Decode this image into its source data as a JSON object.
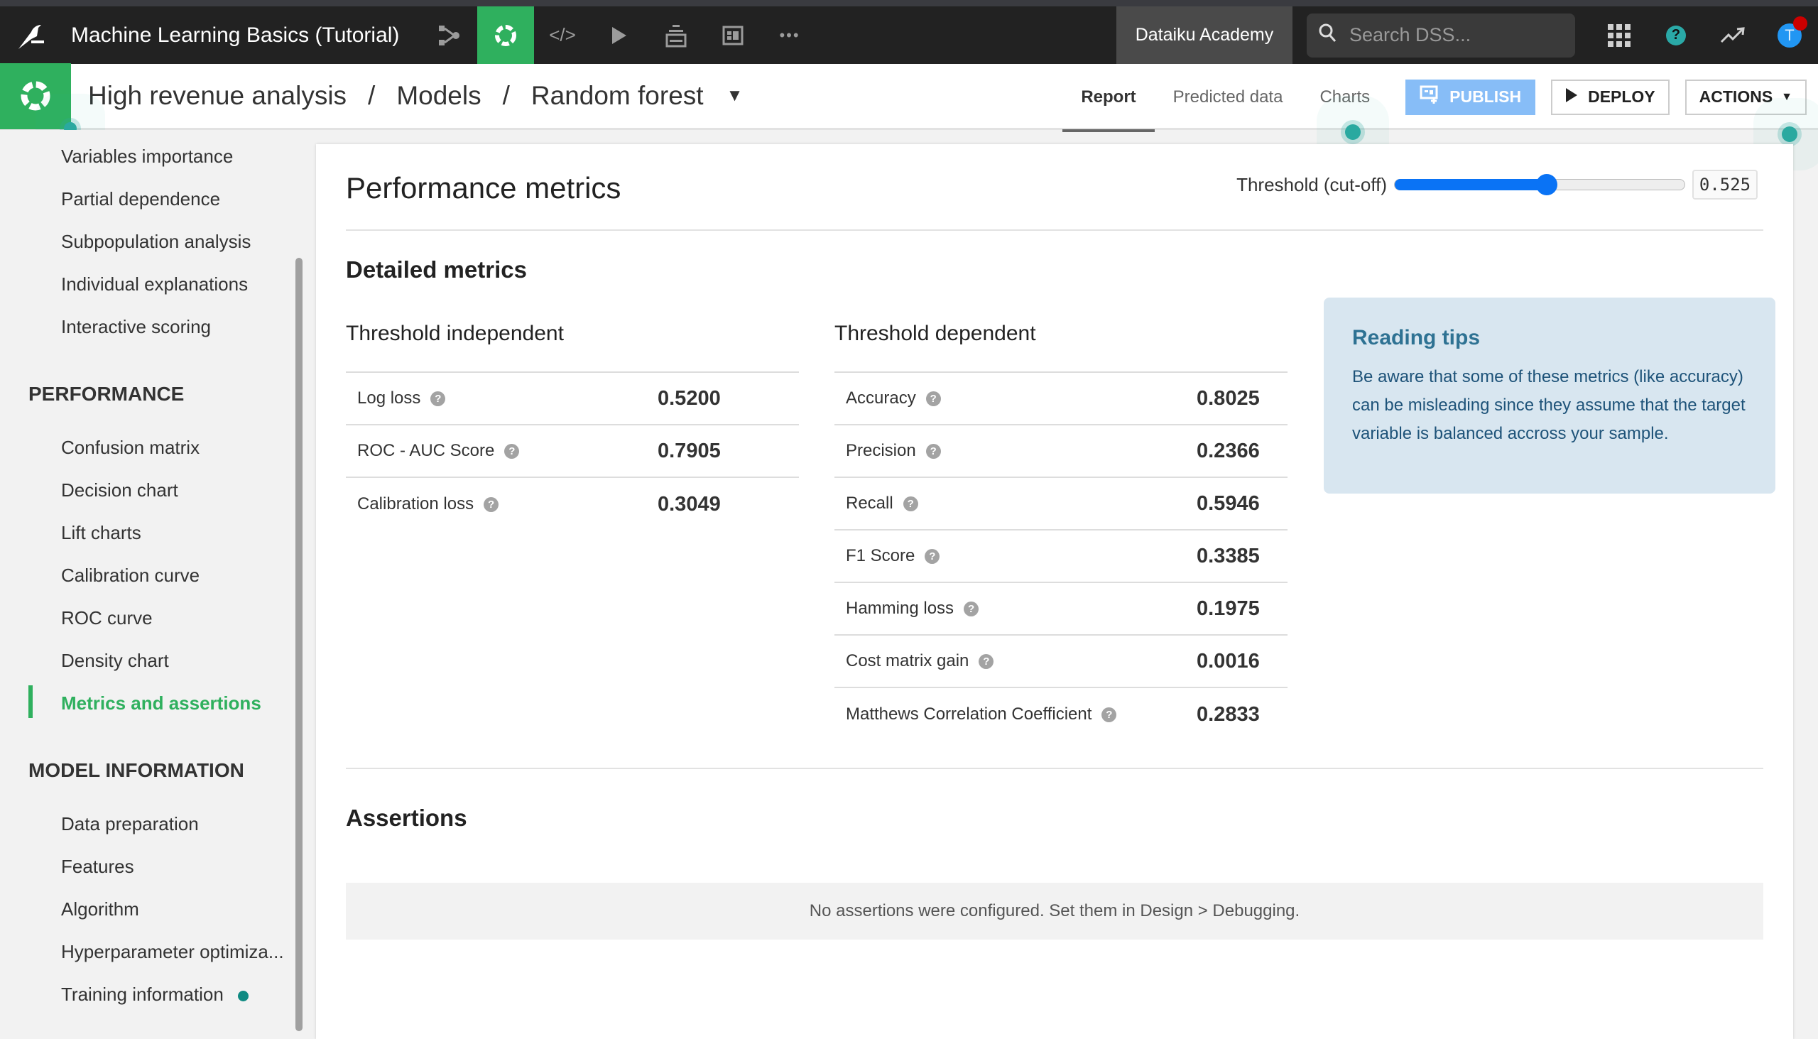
{
  "navbar": {
    "project_title": "Machine Learning Basics (Tutorial)",
    "icons": [
      "flow-icon",
      "ml-icon",
      "code-icon",
      "run-icon",
      "stack-icon",
      "dashboard-icon",
      "more-icon"
    ],
    "academy_label": "Dataiku Academy",
    "search_placeholder": "Search DSS...",
    "avatar_letter": "T"
  },
  "subheader": {
    "breadcrumb": [
      "High revenue analysis",
      "Models",
      "Random forest"
    ],
    "separator": "/",
    "tabs": [
      "Report",
      "Predicted data",
      "Charts"
    ],
    "active_tab": "Report",
    "publish_label": "PUBLISH",
    "deploy_label": "DEPLOY",
    "actions_label": "ACTIONS"
  },
  "sidebar": {
    "items_top": [
      "Variables importance",
      "Partial dependence",
      "Subpopulation analysis",
      "Individual explanations",
      "Interactive scoring"
    ],
    "performance_header": "PERFORMANCE",
    "performance_items": [
      "Confusion matrix",
      "Decision chart",
      "Lift charts",
      "Calibration curve",
      "ROC curve",
      "Density chart",
      "Metrics and assertions"
    ],
    "active_item": "Metrics and assertions",
    "model_info_header": "MODEL INFORMATION",
    "model_info_items": [
      "Data preparation",
      "Features",
      "Algorithm",
      "Hyperparameter optimiza...",
      "Training information"
    ]
  },
  "main": {
    "title": "Performance metrics",
    "threshold": {
      "label": "Threshold (cut-off)",
      "value": "0.525",
      "value_fraction": 0.525
    },
    "detailed_title": "Detailed metrics",
    "threshold_independent": {
      "title": "Threshold independent",
      "rows": [
        {
          "label": "Log loss",
          "value": "0.5200"
        },
        {
          "label": "ROC - AUC Score",
          "value": "0.7905"
        },
        {
          "label": "Calibration loss",
          "value": "0.3049"
        }
      ]
    },
    "threshold_dependent": {
      "title": "Threshold dependent",
      "rows": [
        {
          "label": "Accuracy",
          "value": "0.8025"
        },
        {
          "label": "Precision",
          "value": "0.2366"
        },
        {
          "label": "Recall",
          "value": "0.5946"
        },
        {
          "label": "F1 Score",
          "value": "0.3385"
        },
        {
          "label": "Hamming loss",
          "value": "0.1975"
        },
        {
          "label": "Cost matrix gain",
          "value": "0.0016"
        },
        {
          "label": "Matthews Correlation Coefficient",
          "value": "0.2833"
        }
      ]
    },
    "tips": {
      "title": "Reading tips",
      "body": "Be aware that some of these metrics (like accuracy) can be misleading since they assume that the target variable is balanced accross your sample."
    },
    "assertions": {
      "title": "Assertions",
      "empty_message": "No assertions were configured. Set them in Design > Debugging."
    }
  },
  "colors": {
    "accent_green": "#2fb05e",
    "slider_blue": "#0a73f5",
    "publish_blue": "#87bdf7",
    "tips_bg": "#d8e6f0",
    "tips_title": "#2e7293"
  }
}
